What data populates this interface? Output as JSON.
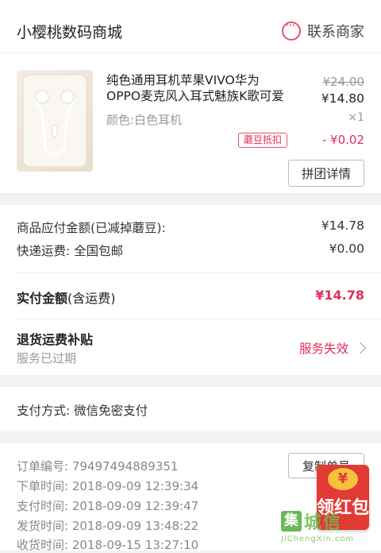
{
  "shop": {
    "name": "小樱桃数码商城",
    "contact_label": "联系商家"
  },
  "product": {
    "title": "纯色通用耳机苹果VIVO华为OPPO麦克风入耳式魅族K歌可爱",
    "color": "颜色:白色耳机",
    "original_price": "¥24.00",
    "price": "¥14.80",
    "quantity": "×1",
    "discount_badge": "蘑豆抵扣",
    "discount_value": "- ¥0.02",
    "group_button": "拼团详情"
  },
  "amounts": {
    "payable_label": "商品应付金额(已减掉蘑豆):",
    "payable_value": "¥14.78",
    "shipping_label": "快递运费: 全国包邮",
    "shipping_value": "¥0.00",
    "total_label": "实付金额",
    "total_suffix": "(含运费)",
    "total_value": "¥14.78",
    "refund_title": "退货运费补贴",
    "refund_sub": "服务已过期",
    "refund_status": "服务失效"
  },
  "payment": {
    "text": "支付方式: 微信免密支付"
  },
  "order": {
    "copy_button": "复制单号",
    "lines": [
      {
        "label": "订单编号:",
        "value": "79497494889351"
      },
      {
        "label": "下单时间:",
        "value": "2018-09-09  12:39:34"
      },
      {
        "label": "支付时间:",
        "value": "2018-09-09  12:39:47"
      },
      {
        "label": "发货时间:",
        "value": "2018-09-09  13:48:22"
      },
      {
        "label": "收货时间:",
        "value": "2018-09-15  13:27:10"
      }
    ]
  },
  "redpacket": {
    "coin": "¥",
    "label": "领红包"
  },
  "watermark": {
    "box": "集",
    "text": "城信",
    "url": "JiChengXin.com"
  }
}
